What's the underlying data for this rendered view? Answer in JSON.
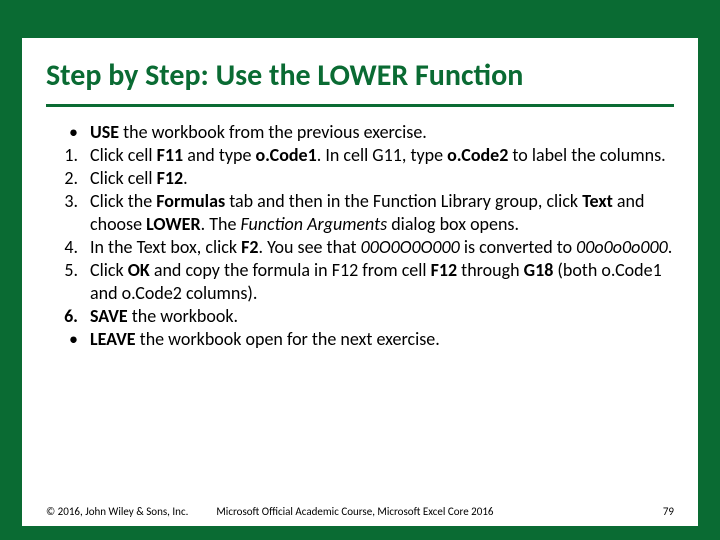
{
  "title": "Step by Step: Use the LOWER Function",
  "items": [
    {
      "marker": "•",
      "bold_marker": false,
      "segs": [
        {
          "t": "USE",
          "b": true
        },
        {
          "t": " the workbook from the previous exercise."
        }
      ]
    },
    {
      "marker": "1.",
      "bold_marker": false,
      "segs": [
        {
          "t": "Click cell "
        },
        {
          "t": "F11",
          "b": true
        },
        {
          "t": " and type "
        },
        {
          "t": "o.Code1",
          "b": true
        },
        {
          "t": ". In cell G11, type "
        },
        {
          "t": "o.Code2",
          "b": true
        },
        {
          "t": " to label the columns."
        }
      ]
    },
    {
      "marker": "2.",
      "bold_marker": false,
      "segs": [
        {
          "t": "Click cell "
        },
        {
          "t": "F12",
          "b": true
        },
        {
          "t": "."
        }
      ]
    },
    {
      "marker": "3.",
      "bold_marker": false,
      "segs": [
        {
          "t": "Click the "
        },
        {
          "t": "Formulas",
          "b": true
        },
        {
          "t": " tab and then in the Function Library group, click "
        },
        {
          "t": "Text",
          "b": true
        },
        {
          "t": " and choose "
        },
        {
          "t": "LOWER",
          "b": true
        },
        {
          "t": ". The "
        },
        {
          "t": "Function Arguments",
          "i": true
        },
        {
          "t": " dialog box opens."
        }
      ]
    },
    {
      "marker": "4.",
      "bold_marker": false,
      "segs": [
        {
          "t": "In the Text box, click "
        },
        {
          "t": "F2",
          "b": true
        },
        {
          "t": ". You see that "
        },
        {
          "t": "00O0O0O000",
          "i": true
        },
        {
          "t": " is converted to "
        },
        {
          "t": "00o0o0o000",
          "i": true
        },
        {
          "t": "."
        }
      ]
    },
    {
      "marker": "5.",
      "bold_marker": false,
      "segs": [
        {
          "t": "Click "
        },
        {
          "t": "OK",
          "b": true
        },
        {
          "t": " and copy the formula in F12 from cell "
        },
        {
          "t": "F12",
          "b": true
        },
        {
          "t": " through "
        },
        {
          "t": "G18",
          "b": true
        },
        {
          "t": " (both o.Code1 and o.Code2 columns)."
        }
      ]
    },
    {
      "marker": "6.",
      "bold_marker": true,
      "segs": [
        {
          "t": "SAVE",
          "b": true
        },
        {
          "t": " the workbook."
        }
      ]
    },
    {
      "marker": "•",
      "bold_marker": false,
      "segs": [
        {
          "t": "LEAVE",
          "b": true
        },
        {
          "t": " the workbook open for the next exercise."
        }
      ]
    }
  ],
  "footer": {
    "left": "© 2016, John Wiley & Sons, Inc.",
    "mid": "Microsoft Official Academic Course, Microsoft Excel Core 2016",
    "right": "79"
  }
}
